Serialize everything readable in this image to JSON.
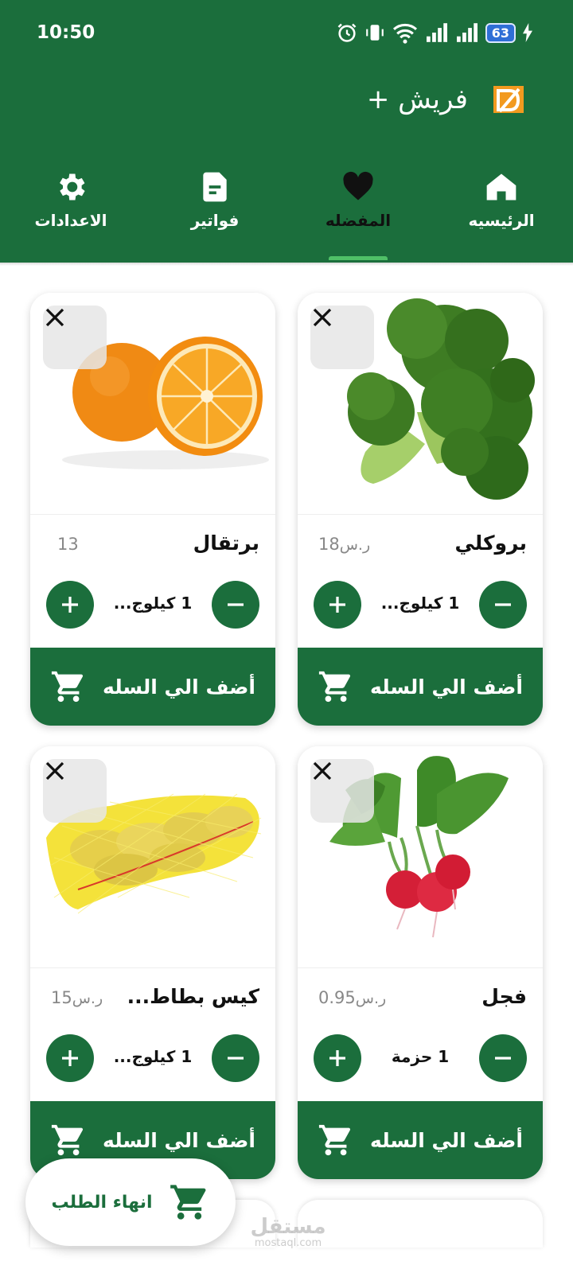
{
  "status_bar": {
    "time": "10:50",
    "battery_level": "63"
  },
  "app_bar": {
    "title": "فريش +",
    "logo_icon": "fresh-plus-logo"
  },
  "tabs": [
    {
      "label": "الرئيسيه",
      "icon": "home-icon",
      "active": false
    },
    {
      "label": "المفضله",
      "icon": "heart-icon",
      "active": true
    },
    {
      "label": "فواتير",
      "icon": "document-icon",
      "active": false
    },
    {
      "label": "الاعدادات",
      "icon": "gear-icon",
      "active": false
    }
  ],
  "products": [
    {
      "name": "بروكلي",
      "price": "18",
      "currency": "ر.س",
      "quantity": "1 كيلوج...",
      "add_label": "أضف الي السله",
      "image": "broccoli"
    },
    {
      "name": "برتقال",
      "price": "13",
      "currency": "",
      "quantity": "1 كيلوج...",
      "add_label": "أضف الي السله",
      "image": "orange"
    },
    {
      "name": "فجل",
      "price": "0.95",
      "currency": "ر.س",
      "quantity": "1 حزمة",
      "add_label": "أضف الي السله",
      "image": "radish"
    },
    {
      "name": "كيس بطاط...",
      "price": "15",
      "currency": "ر.س",
      "quantity": "1 كيلوج...",
      "add_label": "أضف الي السله",
      "image": "potato-bag"
    }
  ],
  "checkout_button": {
    "label": "انهاء الطلب"
  },
  "watermark": {
    "arabic": "مستقل",
    "latin": "mostaql.com"
  },
  "colors": {
    "primary": "#1b6e3c",
    "indicator": "#4fc067",
    "price_text": "#888888"
  }
}
